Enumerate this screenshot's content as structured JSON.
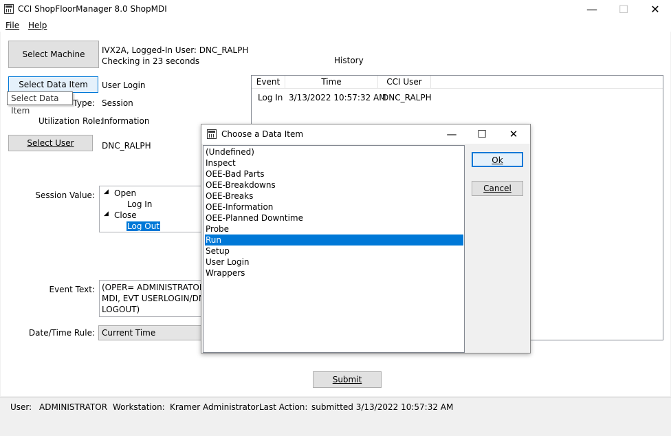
{
  "window": {
    "title": "CCI ShopFloorManager 8.0 ShopMDI",
    "minimize": "—",
    "maximize": "☐",
    "close": "✕"
  },
  "menu": {
    "file": "File",
    "help": "Help"
  },
  "main": {
    "select_machine": "Select Machine",
    "machine_info_line1": "IVX2A, Logged-In User: DNC_RALPH",
    "machine_info_line2": "Checking in 23 seconds",
    "history_label": "History",
    "select_data_item": "Select Data Item",
    "data_item_value": "User Login",
    "tooltip": "Select Data Item",
    "type_label": "Type:",
    "type_value": "Session",
    "util_role_label": "Utilization Role:",
    "util_role_value": "Information",
    "select_user": "Select User",
    "user_value": "DNC_RALPH",
    "session_value_label": "Session Value:",
    "session_tree": {
      "open": "Open",
      "log_in": "Log In",
      "close": "Close",
      "log_out": "Log Out"
    },
    "event_text_label": "Event Text:",
    "event_text_lines": [
      "(OPER= ADMINISTRATOR, S",
      "MDI, EVT USERLOGIN/DNC",
      "LOGOUT)"
    ],
    "date_rule_label": "Date/Time Rule:",
    "date_rule_value": "Current Time",
    "submit": "Submit"
  },
  "history": {
    "columns": [
      "Event",
      "Time",
      "CCI User"
    ],
    "rows": [
      {
        "event": "Log In",
        "time": "3/13/2022 10:57:32 AM",
        "user": "DNC_RALPH"
      }
    ]
  },
  "dialog": {
    "title": "Choose a Data Item",
    "minimize": "—",
    "maximize": "☐",
    "close": "✕",
    "items": [
      "(Undefined)",
      "Inspect",
      "OEE-Bad Parts",
      "OEE-Breakdowns",
      "OEE-Breaks",
      "OEE-Information",
      "OEE-Planned Downtime",
      "Probe",
      "Run",
      "Setup",
      "User Login",
      "Wrappers"
    ],
    "selected_item": "Run",
    "ok": "Ok",
    "cancel": "Cancel"
  },
  "status": {
    "user_label": "User:",
    "user_value": "ADMINISTRATOR",
    "workstation_label": "Workstation:",
    "workstation_value": "Kramer Administrator",
    "last_action_label": "Last Action:",
    "last_action_value": "submitted 3/13/2022 10:57:32 AM"
  },
  "colors": {
    "selection": "#0078d7",
    "button_face": "#e1e1e1",
    "focus_border": "#0078d7"
  }
}
